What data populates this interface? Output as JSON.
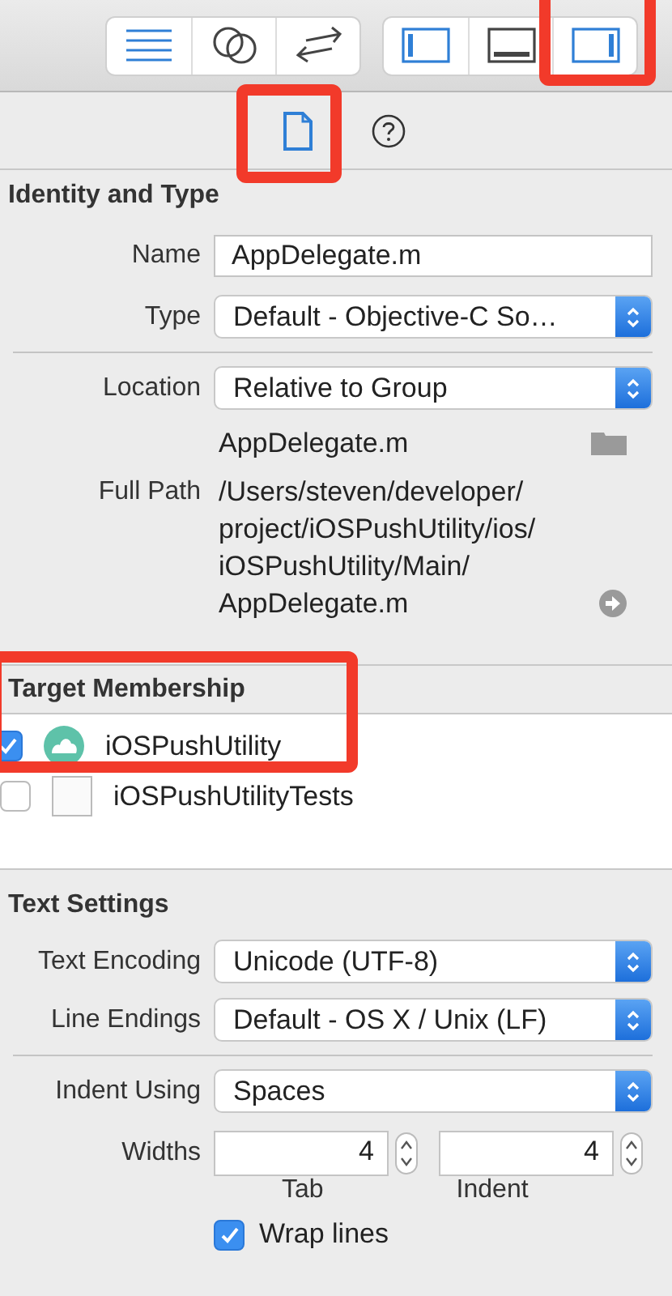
{
  "toolbar": {
    "groups": [
      {
        "buttons": [
          {
            "kind": "lines",
            "selected": true,
            "highlighted": false
          },
          {
            "kind": "circles",
            "selected": false,
            "highlighted": false
          },
          {
            "kind": "arrows",
            "selected": false,
            "highlighted": false
          }
        ]
      },
      {
        "buttons": [
          {
            "kind": "left-panel",
            "selected": true,
            "highlighted": false
          },
          {
            "kind": "bottom-panel",
            "selected": false,
            "highlighted": false
          },
          {
            "kind": "right-panel",
            "selected": true,
            "highlighted": true
          }
        ]
      }
    ]
  },
  "inspector_tabs": [
    {
      "kind": "file",
      "selected": true,
      "highlighted": true
    },
    {
      "kind": "help",
      "selected": false,
      "highlighted": false
    }
  ],
  "identity": {
    "title": "Identity and Type",
    "name": {
      "label": "Name",
      "value": "AppDelegate.m"
    },
    "type": {
      "label": "Type",
      "value": "Default - Objective-C So…"
    },
    "location": {
      "label": "Location",
      "value": "Relative to Group"
    },
    "file_name": "AppDelegate.m",
    "full_path": {
      "label": "Full Path",
      "value": "/Users/steven/developer/project/iOSPushUtility/ios/iOSPushUtility/Main/AppDelegate.m"
    }
  },
  "target_membership": {
    "title": "Target Membership",
    "highlighted": true,
    "targets": [
      {
        "name": "iOSPushUtility",
        "checked": true,
        "kind": "app"
      },
      {
        "name": "iOSPushUtilityTests",
        "checked": false,
        "kind": "tests"
      }
    ]
  },
  "text_settings": {
    "title": "Text Settings",
    "encoding": {
      "label": "Text Encoding",
      "value": "Unicode (UTF-8)"
    },
    "line_endings": {
      "label": "Line Endings",
      "value": "Default - OS X / Unix (LF)"
    },
    "indent_using": {
      "label": "Indent Using",
      "value": "Spaces"
    },
    "widths": {
      "label": "Widths",
      "tab": {
        "value": "4",
        "caption": "Tab"
      },
      "indent": {
        "value": "4",
        "caption": "Indent"
      }
    },
    "wrap_lines": {
      "label": "Wrap lines",
      "checked": true
    }
  }
}
